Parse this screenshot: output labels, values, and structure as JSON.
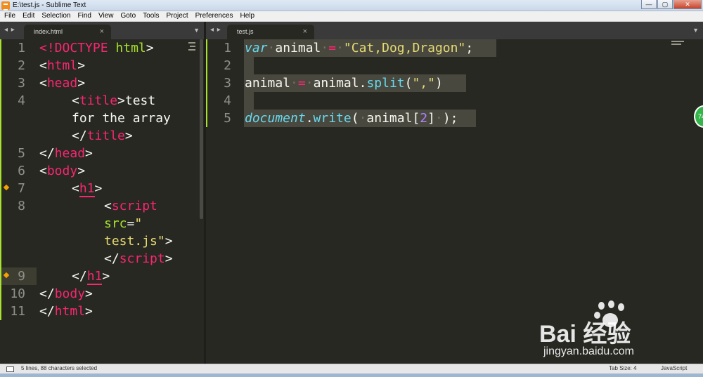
{
  "window": {
    "title": "E:\\test.js - Sublime Text",
    "buttons": {
      "minimize": "—",
      "maximize": "▢",
      "close": "✕"
    }
  },
  "menu": [
    "File",
    "Edit",
    "Selection",
    "Find",
    "View",
    "Goto",
    "Tools",
    "Project",
    "Preferences",
    "Help"
  ],
  "left_pane": {
    "tab_label": "index.html",
    "line_numbers": [
      "1",
      "2",
      "3",
      "4",
      "5",
      "6",
      "7",
      "8",
      "9",
      "10",
      "11"
    ]
  },
  "right_pane": {
    "tab_label": "test.js",
    "line_numbers": [
      "1",
      "2",
      "3",
      "4",
      "5"
    ],
    "code": {
      "l1": {
        "kw": "var",
        "name": "animal",
        "op": "=",
        "str": "\"Cat,Dog,Dragon\"",
        "end": ";"
      },
      "l3": {
        "name": "animal",
        "op": "=",
        "obj": "animal",
        "fn": "split",
        "open": "(",
        "str": "\",\"",
        "close": ")"
      },
      "l5": {
        "obj": "document",
        "fn": "write",
        "open": "(",
        "name": "animal",
        "lb": "[",
        "num": "2",
        "rb": "]",
        "close": ");"
      }
    }
  },
  "html_code": {
    "doctype": "<!DOCTYPE",
    "doctype_name": "html",
    "html_tag": "html",
    "head_tag": "head",
    "title_tag": "title",
    "title_text_1": "test",
    "title_text_2": "for the array",
    "body_tag": "body",
    "h1_tag": "h1",
    "script_tag": "script",
    "src_attr": "src",
    "src_value_start": "\"",
    "src_value_end": "test.js\""
  },
  "badge_text": "74",
  "watermark": {
    "brand": "Bai  经验",
    "url": "jingyan.baidu.com"
  },
  "status": {
    "selection": "5 lines, 88 characters selected",
    "tab_size": "Tab Size: 4",
    "syntax": "JavaScript"
  },
  "colors": {
    "background": "#272822",
    "tag": "#f92672",
    "string": "#e6db74",
    "keyword": "#66d9ef",
    "number": "#ae81ff",
    "attr": "#a6e22e"
  }
}
